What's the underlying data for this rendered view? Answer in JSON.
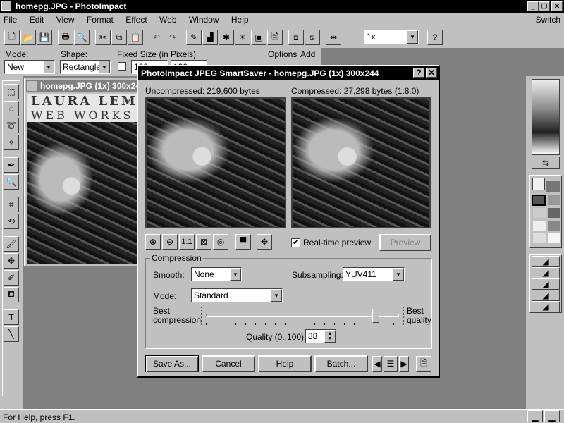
{
  "app": {
    "title": "homepg.JPG - PhotoImpact",
    "switch": "Switch"
  },
  "menu": [
    "File",
    "Edit",
    "View",
    "Format",
    "Effect",
    "Web",
    "Window",
    "Help"
  ],
  "toolbar": {
    "zoom_value": "1x"
  },
  "attributes": {
    "mode_label": "Mode:",
    "mode_value": "New",
    "shape_label": "Shape:",
    "shape_value": "Rectangle",
    "fixed_label": "Fixed Size (in Pixels)",
    "fixed_w": "100",
    "fixed_h": "100",
    "options_label": "Options",
    "add_label": "Add"
  },
  "document": {
    "title": "homepg.JPG (1x) 300x24",
    "banner_line1": "LAURA LEMA",
    "banner_line2": "WEB WORKS"
  },
  "dialog": {
    "title": "PhotoImpact JPEG SmartSaver - homepg.JPG (1x) 300x244",
    "uncompressed": "Uncompressed: 219,600 bytes",
    "compressed": "Compressed: 27,298 bytes (1:8.0)",
    "realtime_label": "Real-time preview",
    "realtime_checked": true,
    "preview_button": "Preview",
    "compression_group": "Compression",
    "smooth_label": "Smooth:",
    "smooth_value": "None",
    "subsampling_label": "Subsampling:",
    "subsampling_value": "YUV411",
    "mode_label": "Mode:",
    "mode_value": "Standard",
    "best_compression": "Best compression",
    "best_quality": "Best quality",
    "quality_label": "Quality (0..100):",
    "quality_value": "88",
    "quality_fraction": 0.88,
    "buttons": {
      "save_as": "Save As...",
      "cancel": "Cancel",
      "help": "Help",
      "batch": "Batch..."
    }
  },
  "status": {
    "text": "For Help, press F1."
  }
}
